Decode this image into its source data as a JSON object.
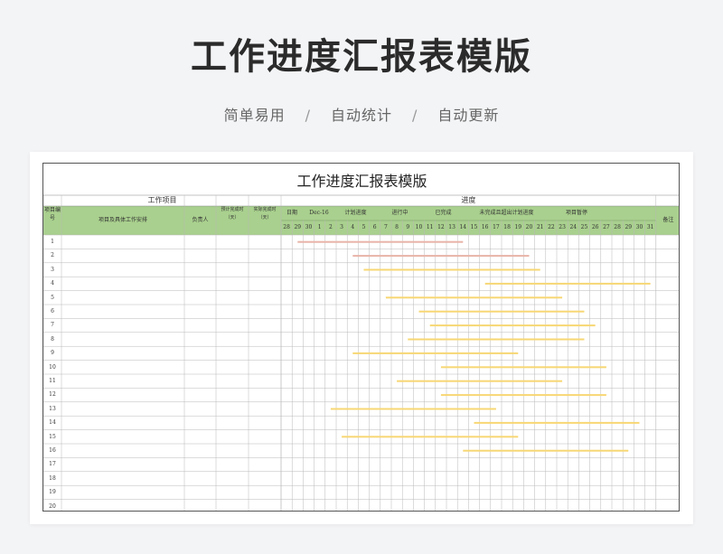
{
  "hero": {
    "title": "工作进度汇报表模版",
    "tags": [
      "简单易用",
      "自动统计",
      "自动更新"
    ],
    "separator": "/"
  },
  "sheet": {
    "title": "工作进度汇报表模版",
    "group_work": "工作项目",
    "group_progress": "进度",
    "col_id": "项目编号",
    "col_task": "项目及具体工作安排",
    "col_owner": "负责人",
    "col_plan": "预计完成时（天）",
    "col_actual": "实际完成时（天）",
    "col_remark": "备注",
    "date_label": "日期",
    "month_label": "Dec-16",
    "legend": {
      "planned": "计划进度",
      "in_progress": "进行中",
      "done": "已完成",
      "overdue": "未完成且超出计划进度",
      "paused": "项目暂停"
    },
    "days": [
      "28",
      "29",
      "30",
      "1",
      "2",
      "3",
      "4",
      "5",
      "6",
      "7",
      "8",
      "9",
      "10",
      "11",
      "12",
      "13",
      "14",
      "15",
      "16",
      "17",
      "18",
      "19",
      "20",
      "21",
      "22",
      "23",
      "24",
      "25",
      "26",
      "27",
      "28",
      "29",
      "30",
      "31"
    ],
    "row_ids": [
      "1",
      "2",
      "3",
      "4",
      "5",
      "6",
      "7",
      "8",
      "9",
      "10",
      "11",
      "12",
      "13",
      "14",
      "15",
      "16",
      "17",
      "18",
      "19",
      "20"
    ]
  },
  "chart_data": {
    "type": "gantt",
    "bars": [
      {
        "row": 1,
        "start": 2,
        "end": 17,
        "color": "#e8b4a8"
      },
      {
        "row": 2,
        "start": 7,
        "end": 23,
        "color": "#e8b4a8"
      },
      {
        "row": 3,
        "start": 8,
        "end": 24,
        "color": "#f7d774"
      },
      {
        "row": 4,
        "start": 19,
        "end": 34,
        "color": "#f7d774"
      },
      {
        "row": 5,
        "start": 10,
        "end": 26,
        "color": "#f7d774"
      },
      {
        "row": 6,
        "start": 13,
        "end": 28,
        "color": "#f7d774"
      },
      {
        "row": 7,
        "start": 14,
        "end": 29,
        "color": "#f7d774"
      },
      {
        "row": 8,
        "start": 12,
        "end": 28,
        "color": "#f7d774"
      },
      {
        "row": 9,
        "start": 7,
        "end": 22,
        "color": "#f7d774"
      },
      {
        "row": 10,
        "start": 15,
        "end": 30,
        "color": "#f7d774"
      },
      {
        "row": 11,
        "start": 11,
        "end": 26,
        "color": "#f7d774"
      },
      {
        "row": 12,
        "start": 15,
        "end": 30,
        "color": "#f7d774"
      },
      {
        "row": 13,
        "start": 5,
        "end": 20,
        "color": "#f7d774"
      },
      {
        "row": 14,
        "start": 18,
        "end": 33,
        "color": "#f7d774"
      },
      {
        "row": 15,
        "start": 6,
        "end": 22,
        "color": "#f7d774"
      },
      {
        "row": 16,
        "start": 17,
        "end": 32,
        "color": "#f7d774"
      }
    ]
  },
  "colors": {
    "header_green": "#a9d08e",
    "grid": "#b8b8b8",
    "yellow": "#f7d774",
    "salmon": "#e8b4a8"
  }
}
